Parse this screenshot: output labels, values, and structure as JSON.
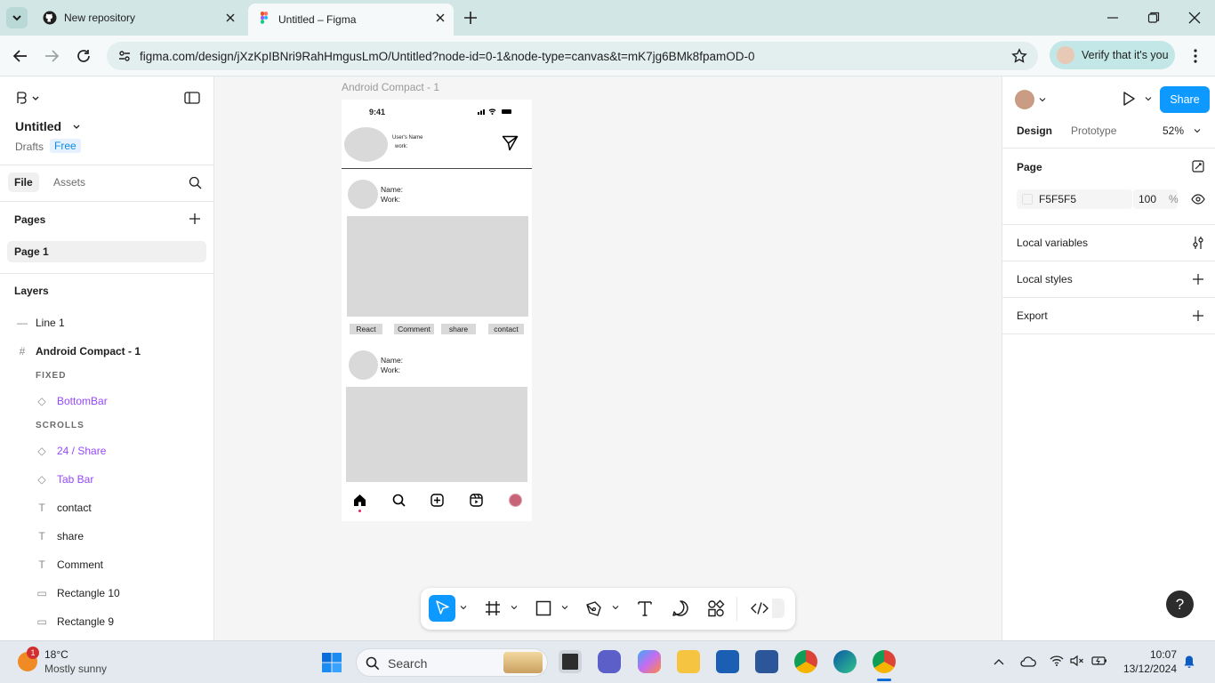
{
  "browser": {
    "tabs": [
      {
        "title": "New repository",
        "icon": "github-icon"
      },
      {
        "title": "Untitled – Figma",
        "icon": "figma-icon",
        "active": true
      }
    ],
    "url": "figma.com/design/jXzKpIBNri9RahHmgusLmO/Untitled?node-id=0-1&node-type=canvas&t=mK7jg6BMk8fpamOD-0",
    "verify_label": "Verify that it's you"
  },
  "figma": {
    "file_title": "Untitled",
    "drafts_label": "Drafts",
    "plan_badge": "Free",
    "left_tabs": {
      "file": "File",
      "assets": "Assets"
    },
    "pages_heading": "Pages",
    "pages": [
      "Page 1"
    ],
    "layers_heading": "Layers",
    "layers": {
      "line1": "Line 1",
      "frame": "Android Compact - 1",
      "group_fixed": "FIXED",
      "bottom_bar": "BottomBar",
      "group_scrolls": "SCROLLS",
      "share24": "24 / Share",
      "tab_bar": "Tab Bar",
      "contact": "contact",
      "share": "share",
      "comment": "Comment",
      "rect10": "Rectangle 10",
      "rect9": "Rectangle 9"
    },
    "canvas": {
      "frame_label": "Android Compact - 1",
      "phone": {
        "time": "9:41",
        "user_name": "User's Name",
        "user_work": "work:",
        "post1_name": "Name:",
        "post1_work": "Work:",
        "buttons": [
          "React",
          "Comment",
          "share",
          "contact"
        ],
        "post2_name": "Name:",
        "post2_work": "Work:"
      }
    },
    "right": {
      "share_label": "Share",
      "tab_design": "Design",
      "tab_prototype": "Prototype",
      "zoom": "52%",
      "page_heading": "Page",
      "page_color": "F5F5F5",
      "page_opacity": "100",
      "percent": "%",
      "local_variables": "Local variables",
      "local_styles": "Local styles",
      "export": "Export",
      "help": "?"
    },
    "colors": {
      "accent": "#0d99ff",
      "component": "#9747ff"
    }
  },
  "taskbar": {
    "weather_temp": "18°C",
    "weather_desc": "Mostly sunny",
    "weather_badge": "1",
    "search_label": "Search",
    "time": "10:07",
    "date": "13/12/2024"
  }
}
